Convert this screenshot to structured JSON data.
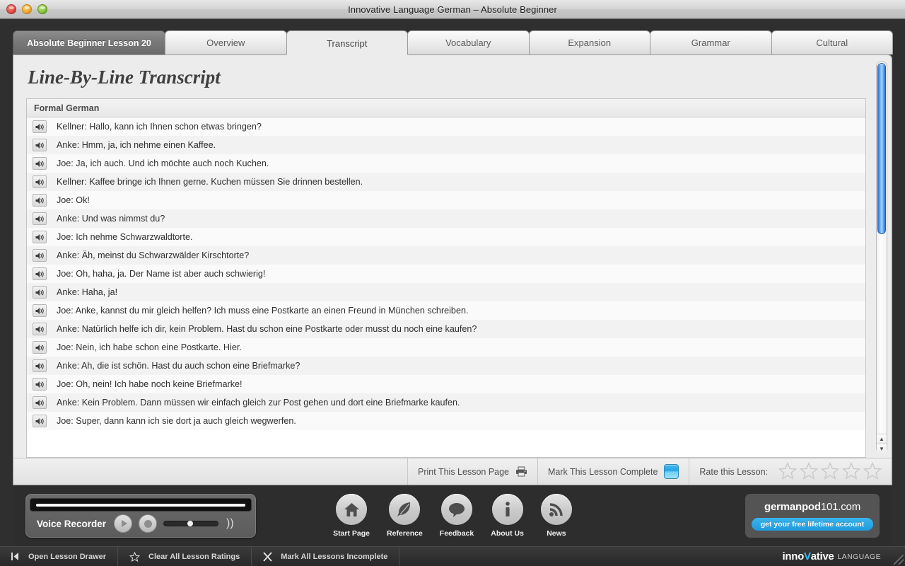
{
  "window": {
    "title": "Innovative Language German – Absolute Beginner",
    "controls": {
      "close": "close",
      "minimize": "minimize",
      "zoom": "zoom"
    }
  },
  "tabs": [
    {
      "label": "Absolute Beginner Lesson 20",
      "kind": "lesson",
      "active": false
    },
    {
      "label": "Overview",
      "kind": "tab",
      "active": false
    },
    {
      "label": "Transcript",
      "kind": "tab",
      "active": true
    },
    {
      "label": "Vocabulary",
      "kind": "tab",
      "active": false
    },
    {
      "label": "Expansion",
      "kind": "tab",
      "active": false
    },
    {
      "label": "Grammar",
      "kind": "tab",
      "active": false
    },
    {
      "label": "Cultural",
      "kind": "tab",
      "active": false
    }
  ],
  "page": {
    "title": "Line-By-Line Transcript",
    "section_header": "Formal German"
  },
  "transcript": [
    "Kellner: Hallo, kann ich Ihnen schon etwas bringen?",
    "Anke: Hmm, ja, ich nehme einen Kaffee.",
    "Joe: Ja, ich auch. Und ich möchte auch noch Kuchen.",
    "Kellner: Kaffee bringe ich Ihnen gerne. Kuchen müssen Sie drinnen bestellen.",
    "Joe: Ok!",
    "Anke: Und was nimmst du?",
    "Joe: Ich nehme Schwarzwaldtorte.",
    "Anke: Äh, meinst du Schwarzwälder Kirschtorte?",
    "Joe: Oh, haha, ja. Der Name ist aber auch schwierig!",
    "Anke: Haha, ja!",
    "Joe: Anke, kannst du mir gleich helfen? Ich muss eine Postkarte an einen Freund in München schreiben.",
    "Anke: Natürlich helfe ich dir, kein Problem. Hast du schon eine Postkarte oder musst du noch eine kaufen?",
    "Joe: Nein, ich habe schon eine Postkarte. Hier.",
    "Anke: Ah, die ist schön. Hast du auch schon eine Briefmarke?",
    "Joe: Oh, nein! Ich habe noch keine Briefmarke!",
    "Anke: Kein Problem. Dann müssen wir einfach gleich zur Post gehen und dort eine Briefmarke kaufen.",
    "Joe: Super, dann kann ich sie dort ja auch gleich wegwerfen."
  ],
  "card_footer": {
    "print_label": "Print This Lesson Page",
    "mark_complete_label": "Mark This Lesson Complete",
    "rate_label": "Rate this Lesson:",
    "stars": [
      1,
      2,
      3,
      4,
      5
    ],
    "stars_filled": 0
  },
  "recorder": {
    "label": "Voice Recorder",
    "play_icon": "play-icon",
    "record_icon": "record-icon",
    "volume_icon": "volume-icon",
    "volume_value": 44
  },
  "nav": [
    {
      "label": "Start Page",
      "icon": "home-icon"
    },
    {
      "label": "Reference",
      "icon": "feather-icon"
    },
    {
      "label": "Feedback",
      "icon": "speech-bubble-icon"
    },
    {
      "label": "About Us",
      "icon": "info-icon"
    },
    {
      "label": "News",
      "icon": "rss-icon"
    }
  ],
  "promo": {
    "brand_bold": "germanpod",
    "brand_rest": "101.com",
    "cta": "get your free lifetime account",
    "accent": "#2ba5e4"
  },
  "statusbar": {
    "items": [
      {
        "label": "Open Lesson Drawer",
        "icon": "drawer-icon"
      },
      {
        "label": "Clear All Lesson Ratings",
        "icon": "star-outline-icon"
      },
      {
        "label": "Mark All Lessons Incomplete",
        "icon": "x-icon"
      }
    ],
    "brand_a": "inno",
    "brand_v": "V",
    "brand_b": "ative",
    "brand_sub": "LANGUAGE"
  },
  "scrollbar": {
    "thumb_top_pct": 1,
    "thumb_height_pct": 45
  }
}
